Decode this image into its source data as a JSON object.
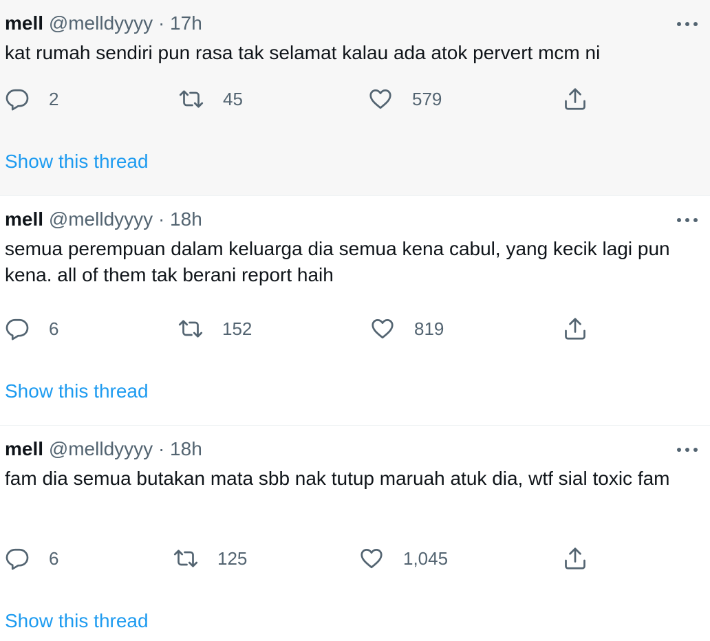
{
  "tweets": [
    {
      "name": "mell",
      "handle": "@melldyyyy",
      "separator": "·",
      "time": "17h",
      "text": "kat rumah sendiri pun rasa tak selamat kalau ada atok pervert mcm ni",
      "replies": "2",
      "retweets": "45",
      "likes": "579",
      "show_thread": "Show this thread"
    },
    {
      "name": "mell",
      "handle": "@melldyyyy",
      "separator": "·",
      "time": "18h",
      "text": "semua perempuan dalam keluarga dia semua kena cabul, yang kecik lagi pun kena. all of them tak berani report haih",
      "replies": "6",
      "retweets": "152",
      "likes": "819",
      "show_thread": "Show this thread"
    },
    {
      "name": "mell",
      "handle": "@melldyyyy",
      "separator": "·",
      "time": "18h",
      "text": "fam dia semua butakan mata sbb nak tutup maruah atuk dia, wtf sial toxic fam",
      "replies": "6",
      "retweets": "125",
      "likes": "1,045",
      "show_thread": "Show this thread"
    }
  ],
  "icons": {
    "reply": "reply-icon",
    "retweet": "retweet-icon",
    "like": "like-icon",
    "share": "share-icon",
    "more": "more-icon"
  },
  "colors": {
    "text": "#0f1419",
    "secondary": "#536471",
    "link": "#1d9bf0",
    "highlight_bg": "#f7f7f7"
  }
}
